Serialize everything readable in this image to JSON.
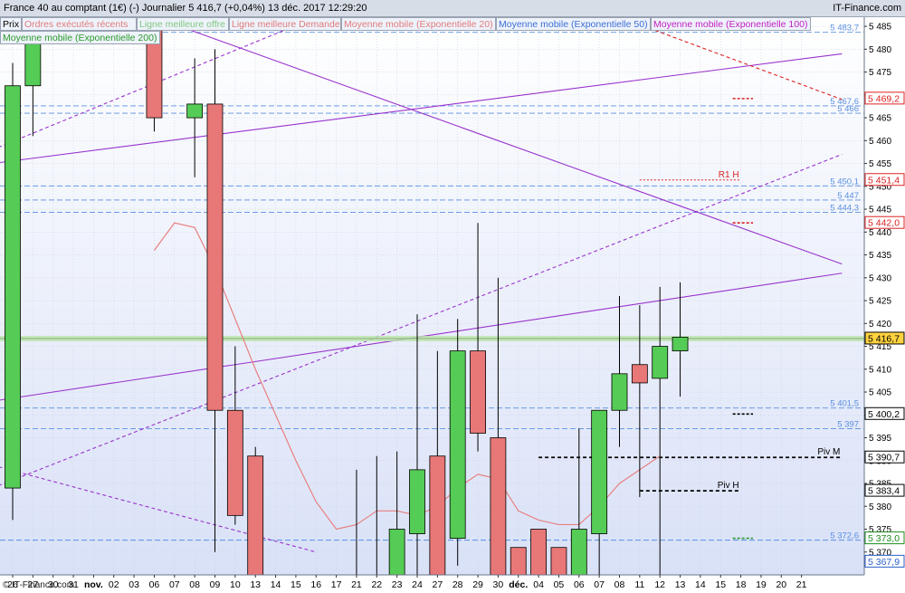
{
  "header": {
    "title": "France 40 au comptant (1€) (-)   Journalier   5 416,7 (+0,04%)   13 déc. 2017 12:29:20",
    "brand": "IT-Finance.com"
  },
  "tabs": [
    {
      "label": "Prix",
      "color": "#000000"
    },
    {
      "label": "Ordres exécutés récents",
      "color": "#e07b7b"
    },
    {
      "label": "Ligne meilleure offre",
      "color": "#7ec87e"
    },
    {
      "label": "Ligne meilleure Demande",
      "color": "#e07b7b"
    },
    {
      "label": "Moyenne mobile (Exponentielle 20)",
      "color": "#e07b7b"
    },
    {
      "label": "Moyenne mobile (Exponentielle 50)",
      "color": "#3b6fd6"
    },
    {
      "label": "Moyenne mobile (Exponentielle 100)",
      "color": "#c21ec2"
    },
    {
      "label": "Moyenne mobile (Exponentielle 200)",
      "color": "#2a9a2a"
    }
  ],
  "copyright": "© IT-Finance.com",
  "colors": {
    "up": "#55cc55",
    "down": "#e87777",
    "channel": "#9933cc",
    "ema": "#e88080",
    "level": "#5a8fe0",
    "pivot": "#000000",
    "resistance": "#dd2222"
  },
  "chart_data": {
    "type": "candlestick",
    "ylim": [
      5365,
      5487
    ],
    "y_ticks": [
      "5 485",
      "5 480",
      "5 475",
      "5 470",
      "5 465",
      "5 460",
      "5 455",
      "5 450",
      "5 445",
      "5 440",
      "5 435",
      "5 430",
      "5 425",
      "5 420",
      "5 415",
      "5 410",
      "5 405",
      "5 400",
      "5 395",
      "5 390",
      "5 385",
      "5 380",
      "5 375",
      "5 370"
    ],
    "y_tick_values": [
      5485,
      5480,
      5475,
      5470,
      5465,
      5460,
      5455,
      5450,
      5445,
      5440,
      5435,
      5430,
      5425,
      5420,
      5415,
      5410,
      5405,
      5400,
      5395,
      5390,
      5385,
      5380,
      5375,
      5370
    ],
    "x_labels": [
      "26",
      "27",
      "30",
      "31",
      "nov.",
      "02",
      "03",
      "06",
      "07",
      "08",
      "09",
      "10",
      "13",
      "14",
      "15",
      "16",
      "17",
      "21",
      "22",
      "23",
      "24",
      "27",
      "28",
      "29",
      "30",
      "déc.",
      "04",
      "05",
      "06",
      "07",
      "08",
      "11",
      "12",
      "13",
      "14",
      "15",
      "18",
      "19",
      "20",
      "21"
    ],
    "x_bold": [
      "nov.",
      "déc."
    ],
    "candles": [
      {
        "label": "26",
        "o": 5384,
        "h": 5477,
        "l": 5377,
        "c": 5472
      },
      {
        "label": "27",
        "o": 5472,
        "h": 5489,
        "l": 5461,
        "c": 5489
      },
      {
        "label": "07",
        "o": 5489,
        "h": 5489,
        "l": 5462,
        "c": 5465
      },
      {
        "label": "08",
        "o": 5465,
        "h": 5478,
        "l": 5452,
        "c": 5468
      },
      {
        "label": "09",
        "o": 5468,
        "h": 5480,
        "l": 5370,
        "c": 5401
      },
      {
        "label": "10",
        "o": 5401,
        "h": 5415,
        "l": 5376,
        "c": 5378
      },
      {
        "label": "13",
        "o": 5391,
        "h": 5393,
        "l": 5360,
        "c": 5360
      },
      {
        "label": "21",
        "o": 5360,
        "h": 5388,
        "l": 5360,
        "c": 5360
      },
      {
        "label": "22",
        "o": 5360,
        "h": 5391,
        "l": 5360,
        "c": 5360
      },
      {
        "label": "23",
        "o": 5360,
        "h": 5392,
        "l": 5360,
        "c": 5375
      },
      {
        "label": "24",
        "o": 5374,
        "h": 5422,
        "l": 5364,
        "c": 5388
      },
      {
        "label": "27",
        "o": 5391,
        "h": 5414,
        "l": 5360,
        "c": 5360
      },
      {
        "label": "28",
        "o": 5373,
        "h": 5421,
        "l": 5367,
        "c": 5414
      },
      {
        "label": "29",
        "o": 5414,
        "h": 5442,
        "l": 5392,
        "c": 5396
      },
      {
        "label": "30",
        "o": 5395,
        "h": 5430,
        "l": 5360,
        "c": 5360
      },
      {
        "label": "déc.",
        "o": 5371,
        "h": 5371,
        "l": 5360,
        "c": 5360
      },
      {
        "label": "04",
        "o": 5375,
        "h": 5375,
        "l": 5360,
        "c": 5360
      },
      {
        "label": "05",
        "o": 5371,
        "h": 5371,
        "l": 5360,
        "c": 5360
      },
      {
        "label": "06",
        "o": 5360,
        "h": 5397,
        "l": 5360,
        "c": 5375
      },
      {
        "label": "07",
        "o": 5374,
        "h": 5401,
        "l": 5360,
        "c": 5401
      },
      {
        "label": "08",
        "o": 5401,
        "h": 5426,
        "l": 5393,
        "c": 5409
      },
      {
        "label": "11",
        "o": 5411,
        "h": 5424,
        "l": 5382,
        "c": 5407
      },
      {
        "label": "12",
        "o": 5408,
        "h": 5428,
        "l": 5360,
        "c": 5415
      },
      {
        "label": "13",
        "o": 5414,
        "h": 5429,
        "l": 5404,
        "c": 5417
      }
    ],
    "ema": [
      [
        7,
        5436
      ],
      [
        8,
        5442
      ],
      [
        9,
        5441
      ],
      [
        10,
        5432
      ],
      [
        11,
        5421
      ],
      [
        12,
        5410
      ],
      [
        13,
        5400
      ],
      [
        14,
        5390
      ],
      [
        15,
        5381
      ],
      [
        16,
        5375
      ],
      [
        17,
        5376
      ],
      [
        18,
        5379
      ],
      [
        19,
        5379
      ],
      [
        20,
        5378
      ],
      [
        21,
        5380
      ],
      [
        22,
        5384
      ],
      [
        23,
        5387
      ],
      [
        24,
        5386
      ],
      [
        25,
        5379
      ],
      [
        26,
        5377
      ],
      [
        27,
        5376
      ],
      [
        28,
        5376
      ],
      [
        29,
        5380
      ],
      [
        30,
        5385
      ],
      [
        31,
        5388
      ],
      [
        32,
        5391
      ]
    ],
    "channels": [
      {
        "x1": -1,
        "y1": 5455,
        "x2": 41,
        "y2": 5479,
        "dash": false
      },
      {
        "x1": -1,
        "y1": 5403,
        "x2": 41,
        "y2": 5431,
        "dash": false
      },
      {
        "x1": -1,
        "y1": 5384,
        "x2": 41,
        "y2": 5457,
        "dash": true
      },
      {
        "x1": -1,
        "y1": 5458,
        "x2": 15,
        "y2": 5487,
        "dash": true
      },
      {
        "x1": 7,
        "y1": 5487,
        "x2": 41,
        "y2": 5433,
        "dash": false
      },
      {
        "x1": -1,
        "y1": 5389,
        "x2": 15,
        "y2": 5370,
        "dash": true
      },
      {
        "x1": 30,
        "y1": 5487,
        "x2": 41,
        "y2": 5469,
        "dash": true,
        "color": "#dd2222"
      }
    ],
    "levels": [
      {
        "value": 5483.7,
        "label": "5 483,7"
      },
      {
        "value": 5467.6,
        "label": "5 467,6"
      },
      {
        "value": 5466.0,
        "label": "5 466"
      },
      {
        "value": 5450.1,
        "label": "5 450,1"
      },
      {
        "value": 5447,
        "label": "5 447"
      },
      {
        "value": 5444.3,
        "label": "5 444,3"
      },
      {
        "value": 5401.5,
        "label": "5 401,5"
      },
      {
        "value": 5397,
        "label": "5 397"
      },
      {
        "value": 5372.6,
        "label": "5 372,6"
      }
    ],
    "markers": [
      {
        "label": "R1 H",
        "value": 5451.4,
        "from": 31,
        "to": 36
      },
      {
        "label": "Piv M",
        "value": 5390.7,
        "from": 26,
        "to": 41
      },
      {
        "label": "Piv H",
        "value": 5383.4,
        "from": 31,
        "to": 36
      }
    ],
    "price_tags": [
      {
        "value": 5469.2,
        "label": "5 469,2",
        "style": "red"
      },
      {
        "value": 5451.4,
        "label": "5 451,4",
        "style": "red"
      },
      {
        "value": 5442.0,
        "label": "5 442,0",
        "style": "red"
      },
      {
        "value": 5416.7,
        "label": "5 416,7",
        "style": "current"
      },
      {
        "value": 5400.2,
        "label": "5 400,2",
        "style": "black"
      },
      {
        "value": 5390.7,
        "label": "5 390,7",
        "style": "black"
      },
      {
        "value": 5383.4,
        "label": "5 383,4",
        "style": "black"
      },
      {
        "value": 5373.0,
        "label": "5 373,0",
        "style": "green"
      },
      {
        "value": 5367.9,
        "label": "5 367,9",
        "style": "blue"
      }
    ],
    "current": 5416.7
  }
}
